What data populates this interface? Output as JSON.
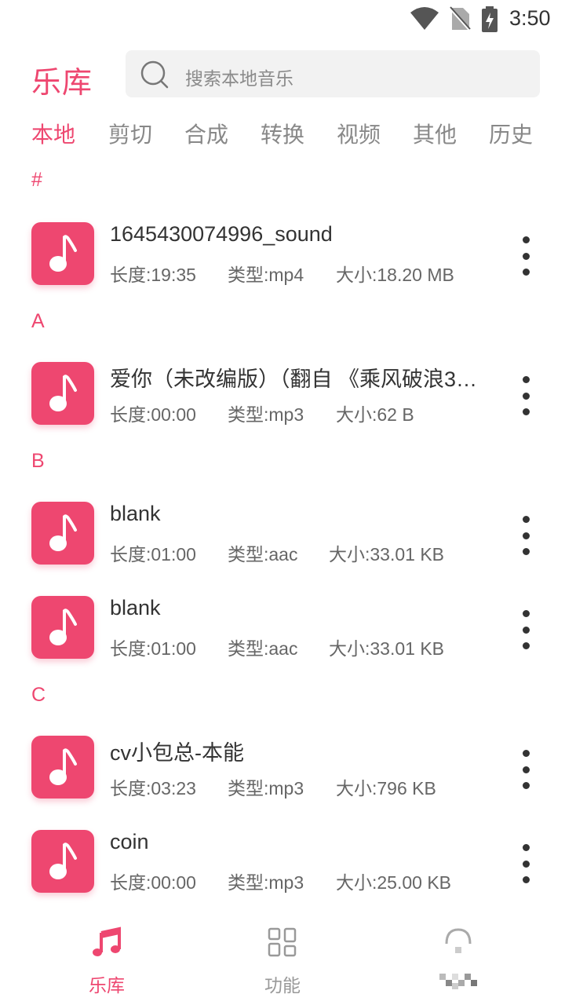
{
  "status_bar": {
    "time": "3:50"
  },
  "header": {
    "title": "乐库",
    "search_placeholder": "搜索本地音乐"
  },
  "tabs": [
    "本地",
    "剪切",
    "合成",
    "转换",
    "视频",
    "其他",
    "历史"
  ],
  "sections": [
    {
      "letter": "#",
      "items": [
        {
          "name": "1645430074996_sound",
          "length": "长度:19:35",
          "type": "类型:mp4",
          "size": "大小:18.20 MB"
        }
      ]
    },
    {
      "letter": "A",
      "items": [
        {
          "name": "爱你（未改编版）（翻自 《乘风破浪3…",
          "length": "长度:00:00",
          "type": "类型:mp3",
          "size": "大小:62 B"
        }
      ]
    },
    {
      "letter": "B",
      "items": [
        {
          "name": "blank",
          "length": "长度:01:00",
          "type": "类型:aac",
          "size": "大小:33.01 KB"
        },
        {
          "name": "blank",
          "length": "长度:01:00",
          "type": "类型:aac",
          "size": "大小:33.01 KB"
        }
      ]
    },
    {
      "letter": "C",
      "items": [
        {
          "name": "cv小包总-本能",
          "length": "长度:03:23",
          "type": "类型:mp3",
          "size": "大小:796 KB"
        },
        {
          "name": "coin",
          "length": "长度:00:00",
          "type": "类型:mp3",
          "size": "大小:25.00 KB"
        }
      ]
    }
  ],
  "bottom_nav": [
    {
      "label": "乐库",
      "icon": "music-note-icon",
      "active": true
    },
    {
      "label": "功能",
      "icon": "grid-icon",
      "active": false
    },
    {
      "label": "",
      "icon": "pixelated-icon",
      "active": false
    }
  ],
  "colors": {
    "accent": "#ee4770",
    "text": "#333333",
    "secondary": "#888888"
  }
}
